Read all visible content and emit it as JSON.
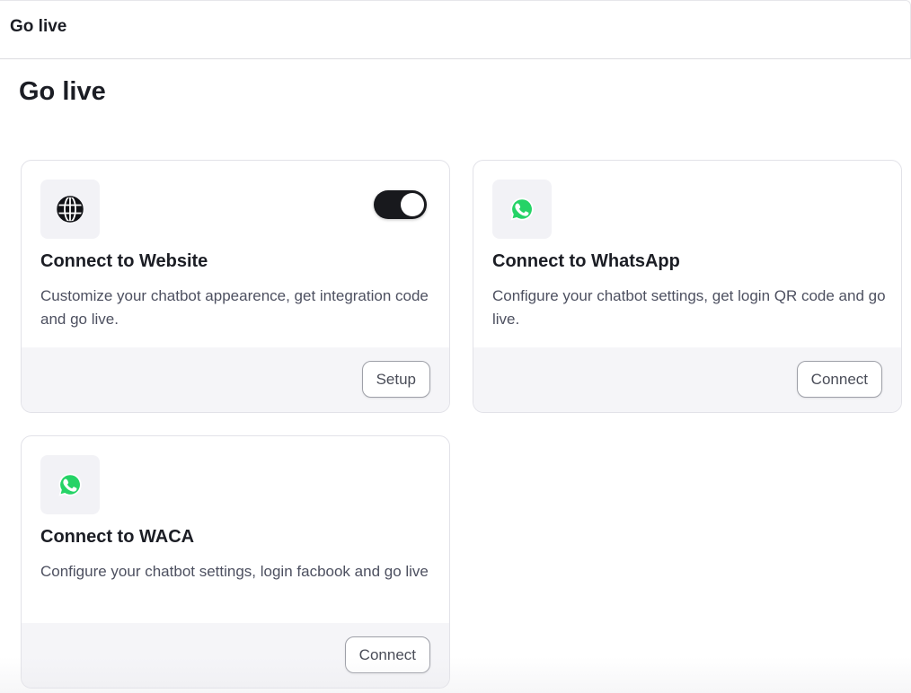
{
  "header": {
    "title": "Go live"
  },
  "page": {
    "title": "Go live"
  },
  "cards": [
    {
      "icon": "globe-icon",
      "title": "Connect to Website",
      "description": "Customize your chatbot appearence, get integration code and go live.",
      "button_label": "Setup",
      "toggle_on": true
    },
    {
      "icon": "whatsapp-icon",
      "title": "Connect to WhatsApp",
      "description": "Configure your chatbot settings, get login QR code and go live.",
      "button_label": "Connect"
    },
    {
      "icon": "whatsapp-icon",
      "title": "Connect to WACA",
      "description": "Configure your chatbot settings, login facbook and go live",
      "button_label": "Connect"
    }
  ],
  "colors": {
    "whatsapp_green": "#25d366",
    "toggle_on": "#18191d",
    "footer_bg": "#f5f5f8"
  }
}
